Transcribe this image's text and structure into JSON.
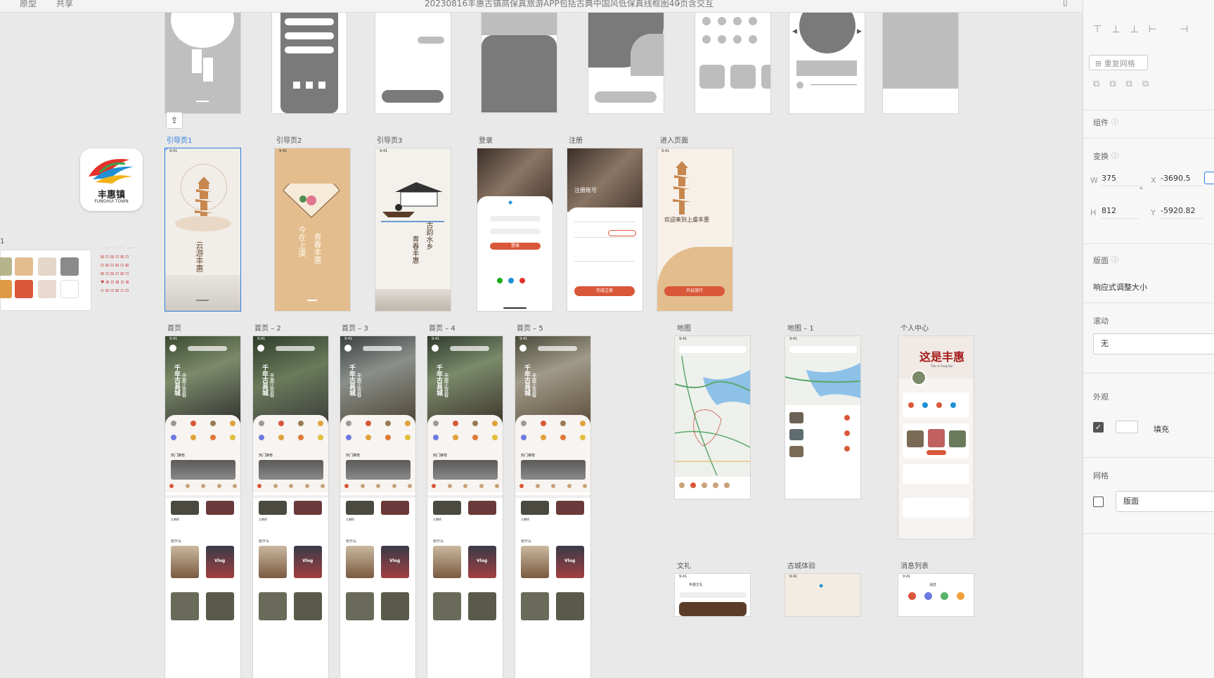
{
  "topbar": {
    "left_a": "原型",
    "left_b": "共享",
    "doc_title": "20230816丰惠古镇高保真旅游APP包括古典中国风低保真线框图40页含交互"
  },
  "logo": {
    "text": "丰惠镇",
    "sub": "FUNGHUI TOWN"
  },
  "labels": {
    "guide1": "引导页1",
    "guide2": "引导页2",
    "guide3": "引导页3",
    "login": "登录",
    "register": "注册",
    "enter": "进入页面",
    "home": "首页",
    "home2": "首页 – 2",
    "home3": "首页 – 3",
    "home4": "首页 – 4",
    "home5": "首页 – 5",
    "map": "地图",
    "map1": "地图 – 1",
    "profile": "个人中心",
    "culture": "文礼",
    "experience": "古城体验",
    "messages": "消息列表",
    "asset_num": "1"
  },
  "screens": {
    "time": "9:41",
    "guide1_text": "云游丰惠",
    "guide2_text": "今在上虞",
    "guide2_text2": "青春丰惠",
    "guide3_text": "古韵水乡",
    "guide3_text2": "青春丰惠",
    "login_btn": "登录",
    "register_title": "注册账号",
    "register_btn": "完成注册",
    "enter_text": "欢迎来到上虞丰惠",
    "enter_btn": "开启旅行",
    "home_vertical": "千年古县城",
    "home_vertical2": "丰惠正青春",
    "home_hot": "热门推荐",
    "home_sec2": "九狮桥",
    "home_sec3": "玩什么",
    "home_vlog": "Vlog",
    "home2_sign": "九狮桥",
    "profile_title": "这是丰惠",
    "profile_sub": "This is Feng Hui",
    "msg_title": "消息",
    "culture_title": "丰惠文礼"
  },
  "panel": {
    "repeat_grid": "重复网格",
    "component": "组件",
    "transform": "变换",
    "w_label": "W",
    "w_val": "375",
    "x_label": "X",
    "x_val": "-3690.5",
    "h_label": "H",
    "h_val": "812",
    "y_label": "Y",
    "y_val": "-5920.82",
    "layout": "版面",
    "responsive": "响应式调整大小",
    "scroll": "滚动",
    "scroll_val": "无",
    "appearance": "外观",
    "fill": "填充",
    "fill_checked": true,
    "grid": "网格",
    "grid_val": "版面",
    "grid_checked": false
  },
  "colors": {
    "accent": "#d9583a",
    "selection": "#2d7ce0",
    "beige": "#e3bd8e",
    "paper": "#f1ede8"
  }
}
